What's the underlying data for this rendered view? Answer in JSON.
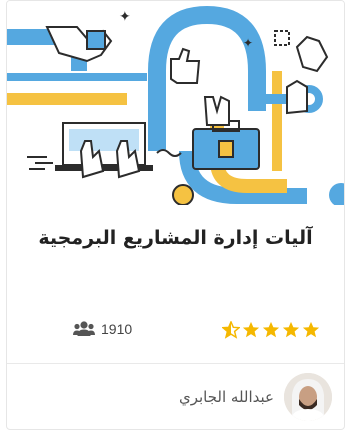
{
  "course": {
    "title": "آليات إدارة المشاريع البرمجية",
    "rating": 5,
    "students_count": "1910",
    "author_name": "عبدالله الجابري"
  },
  "icons": {
    "rating": "star-icon",
    "students": "users-icon",
    "hero": "project-tools-illustration"
  },
  "colors": {
    "star": "#f5b800",
    "blue": "#55a8e0",
    "yellow": "#f5c242",
    "ink": "#2c2c2c"
  }
}
